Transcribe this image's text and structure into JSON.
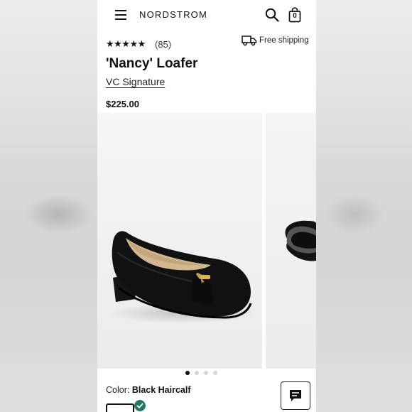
{
  "header": {
    "logo": "NORDSTROM",
    "bag_count": "0"
  },
  "product": {
    "rating_stars": "★★★★★",
    "rating_value": 5,
    "review_count": "(85)",
    "shipping": "Free shipping",
    "title": "'Nancy' Loafer",
    "brand": "VC Signature",
    "price": "$225.00"
  },
  "gallery": {
    "image_count": 4,
    "active_index": 0
  },
  "color": {
    "label": "Color:",
    "value": "Black Haircalf"
  },
  "colors": {
    "accent_check": "#1e7a5e",
    "text": "#111111"
  },
  "icons": {
    "menu": "menu-icon",
    "search": "search-icon",
    "bag": "bag-icon",
    "truck": "truck-icon",
    "chat": "chat-icon",
    "check": "check-icon"
  }
}
